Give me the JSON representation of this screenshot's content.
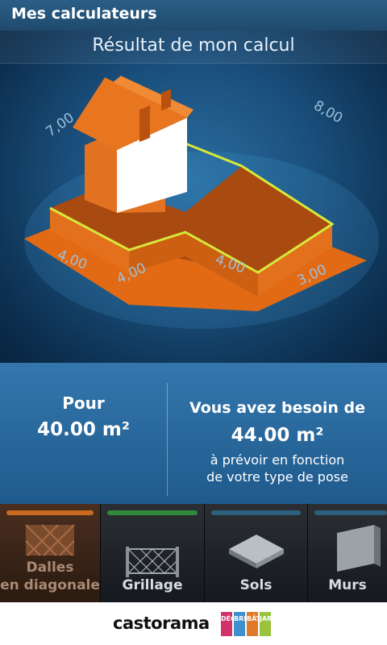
{
  "window": {
    "title": "Mes calculateurs"
  },
  "scene": {
    "title": "Résultat de mon calcul",
    "dimensions": [
      "7,00",
      "8,00",
      "4,00",
      "4,00",
      "4,00",
      "3,00"
    ]
  },
  "result": {
    "pour_label": "Pour",
    "pour_value": "40.00 m²",
    "need_label": "Vous avez besoin de",
    "need_value": "44.00 m²",
    "note_line1": "à prévoir en fonction",
    "note_line2": "de votre type de pose"
  },
  "tabs": [
    {
      "line1": "Dalles",
      "line2": "en diagonale",
      "color": "#c86a22",
      "icon": "diagonal-tiles-icon"
    },
    {
      "line1": "Grillage",
      "line2": "",
      "color": "#2f8a3a",
      "icon": "fence-icon"
    },
    {
      "line1": "Sols",
      "line2": "",
      "color": "#2b5f7c",
      "icon": "floor-tile-icon"
    },
    {
      "line1": "Murs",
      "line2": "",
      "color": "#2b5f7c",
      "icon": "wall-block-icon"
    }
  ],
  "footer": {
    "brand": "castorama",
    "tags": [
      {
        "text": "DÉCO",
        "color": "#d2326c"
      },
      {
        "text": "BRICO",
        "color": "#3f8fcf"
      },
      {
        "text": "BÂTI",
        "color": "#e07a2a"
      },
      {
        "text": "JARDIN",
        "color": "#9bc23c"
      }
    ]
  }
}
